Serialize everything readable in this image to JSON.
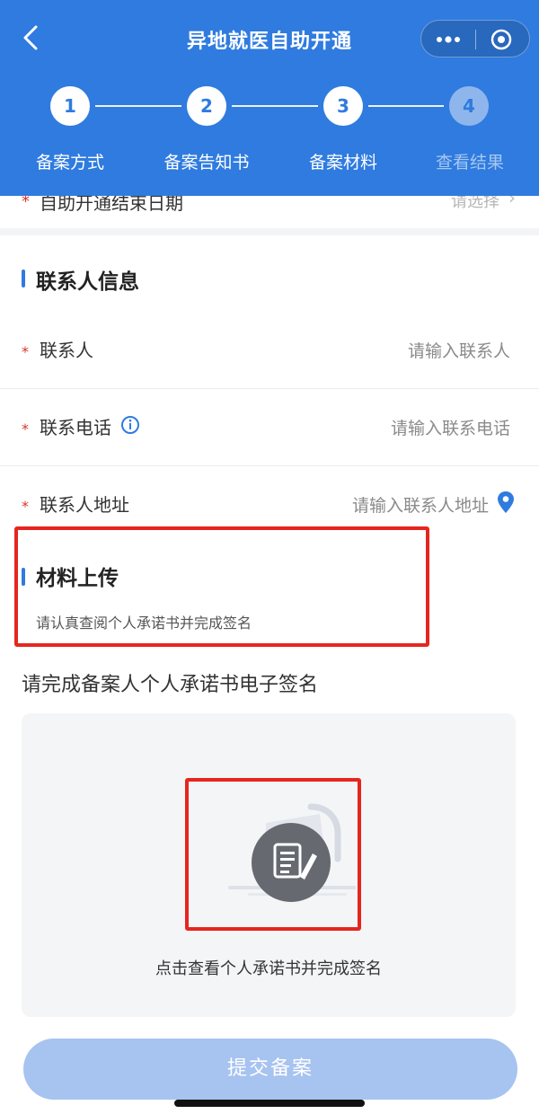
{
  "header": {
    "title": "异地就医自助开通"
  },
  "steps": [
    {
      "number": "1",
      "label": "备案方式"
    },
    {
      "number": "2",
      "label": "备案告知书"
    },
    {
      "number": "3",
      "label": "备案材料"
    },
    {
      "number": "4",
      "label": "查看结果"
    }
  ],
  "partial_row": {
    "label": "自助开通结束日期",
    "placeholder": "请选择"
  },
  "contact": {
    "title": "联系人信息",
    "fields": [
      {
        "label": "联系人",
        "placeholder": "请输入联系人"
      },
      {
        "label": "联系电话",
        "placeholder": "请输入联系电话"
      },
      {
        "label": "联系人地址",
        "placeholder": "请输入联系人地址"
      }
    ]
  },
  "upload": {
    "title": "材料上传",
    "hint": "请认真查阅个人承诺书并完成签名"
  },
  "signature": {
    "title": "请完成备案人个人承诺书电子签名",
    "action_text": "点击查看个人承诺书并完成签名"
  },
  "submit": {
    "label": "提交备案"
  },
  "colors": {
    "primary": "#2f7bdf",
    "required": "#d9362b",
    "highlight": "#e5261f",
    "submit_disabled": "#a7c3f0"
  }
}
